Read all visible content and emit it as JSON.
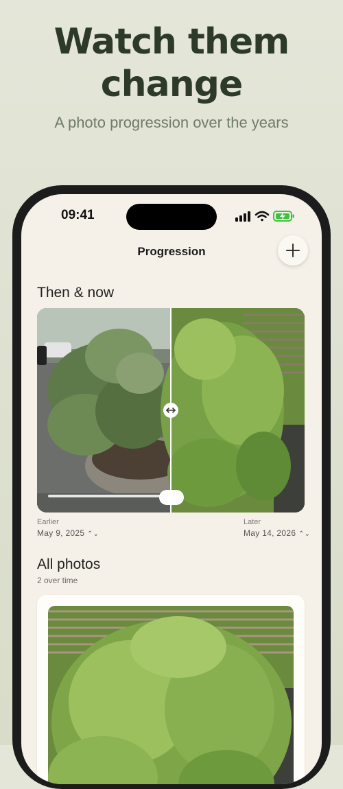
{
  "promo": {
    "headline_line1": "Watch them",
    "headline_line2": "change",
    "subheadline": "A photo progression over the years"
  },
  "status_bar": {
    "time": "09:41",
    "icons": [
      "signal-icon",
      "wifi-icon",
      "battery-charging-icon"
    ]
  },
  "nav": {
    "title": "Progression",
    "add_icon": "plus-icon"
  },
  "then_now": {
    "title": "Then & now",
    "slider_position": 0.5,
    "earlier_label": "Earlier",
    "earlier_date": "May 9, 2025",
    "later_label": "Later",
    "later_date": "May 14, 2026",
    "swap_icon": "arrows-left-right-icon",
    "date_picker_icon": "chevron-up-down-icon"
  },
  "all_photos": {
    "title": "All photos",
    "count_text": "2 over time"
  },
  "colors": {
    "background": "#dfe2d2",
    "headline": "#2d3a2a",
    "screen": "#f6f1e8",
    "phone_frame": "#1c1c1c",
    "battery_green": "#3bc43b"
  }
}
